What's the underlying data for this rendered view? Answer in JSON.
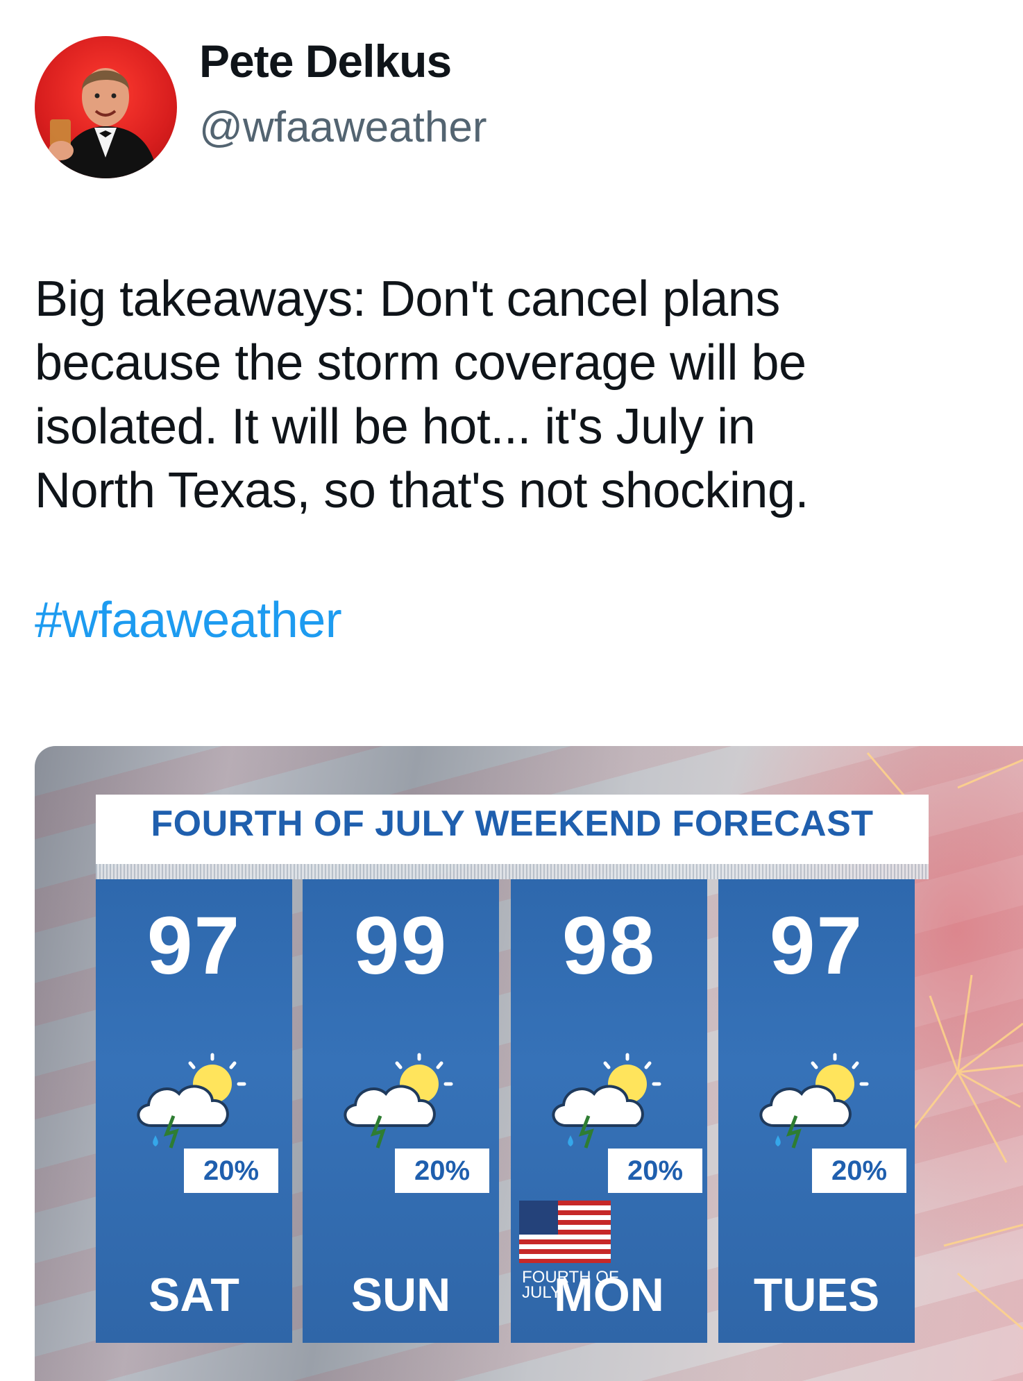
{
  "tweet": {
    "author_name": "Pete Delkus",
    "handle": "@wfaaweather",
    "text": "Big takeaways: Don't cancel plans\nbecause the storm coverage will be\nisolated. It will be hot... it's July in\nNorth Texas, so that's not shocking.",
    "hashtag": "#wfaaweather"
  },
  "forecast": {
    "title": "FOURTH OF JULY WEEKEND FORECAST",
    "days": [
      {
        "name": "SAT",
        "temp": "97",
        "chance": "20%",
        "icon": "partly-cloudy-thunderstorm-icon"
      },
      {
        "name": "SUN",
        "temp": "99",
        "chance": "20%",
        "icon": "partly-cloudy-thunderstorm-icon"
      },
      {
        "name": "MON",
        "temp": "98",
        "chance": "20%",
        "icon": "partly-cloudy-thunderstorm-icon",
        "note": "FOURTH OF JULY"
      },
      {
        "name": "TUES",
        "temp": "97",
        "chance": "20%",
        "icon": "partly-cloudy-thunderstorm-icon"
      }
    ]
  },
  "colors": {
    "hashtag": "#1d9bf0",
    "handle": "#536471",
    "panel_blue": "#3672b8",
    "title_blue": "#1f5fae"
  }
}
